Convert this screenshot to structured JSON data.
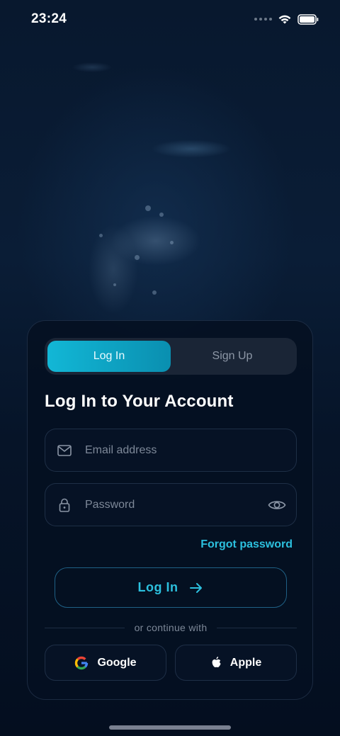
{
  "status_bar": {
    "time": "23:24"
  },
  "tabs": [
    {
      "label": "Log In",
      "active": true
    },
    {
      "label": "Sign Up",
      "active": false
    }
  ],
  "form": {
    "title": "Log In to Your Account",
    "email": {
      "placeholder": "Email address",
      "icon": "mail-icon"
    },
    "password": {
      "placeholder": "Password",
      "icon": "lock-icon",
      "toggle_icon": "eye-icon"
    },
    "forgot_label": "Forgot password",
    "submit_label": "Log In",
    "divider_text": "or continue with"
  },
  "social": [
    {
      "label": "Google",
      "icon": "google-icon"
    },
    {
      "label": "Apple",
      "icon": "apple-icon"
    }
  ],
  "colors": {
    "accent": "#12b7d6",
    "link": "#2cc0de",
    "background": "#051226"
  }
}
